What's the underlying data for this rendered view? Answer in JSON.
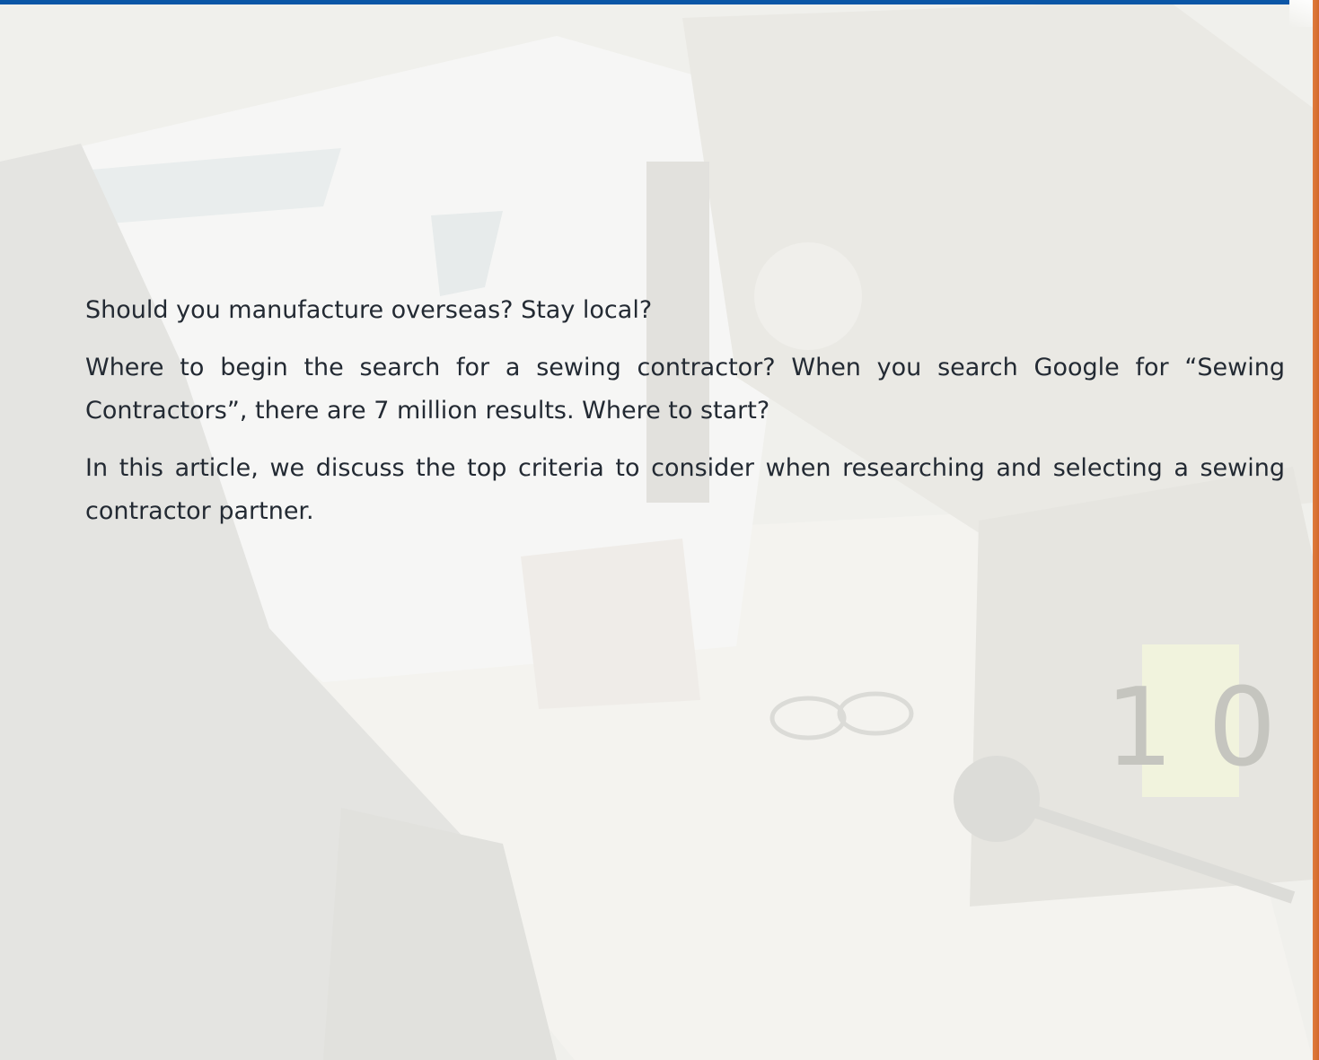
{
  "article": {
    "paragraphs": [
      "Should you manufacture overseas? Stay local?",
      "Where to begin the search for a sewing contractor? When you search Google for “Sewing Contractors”, there are 7 million results. Where to start?",
      "In this article, we discuss the top criteria to consider when researching and selecting a sewing contractor partner."
    ]
  },
  "background": {
    "machine_label": "1 0"
  },
  "colors": {
    "top_bar": "#0a56a6",
    "right_edge": "#e07b3c",
    "text": "#232a33"
  }
}
